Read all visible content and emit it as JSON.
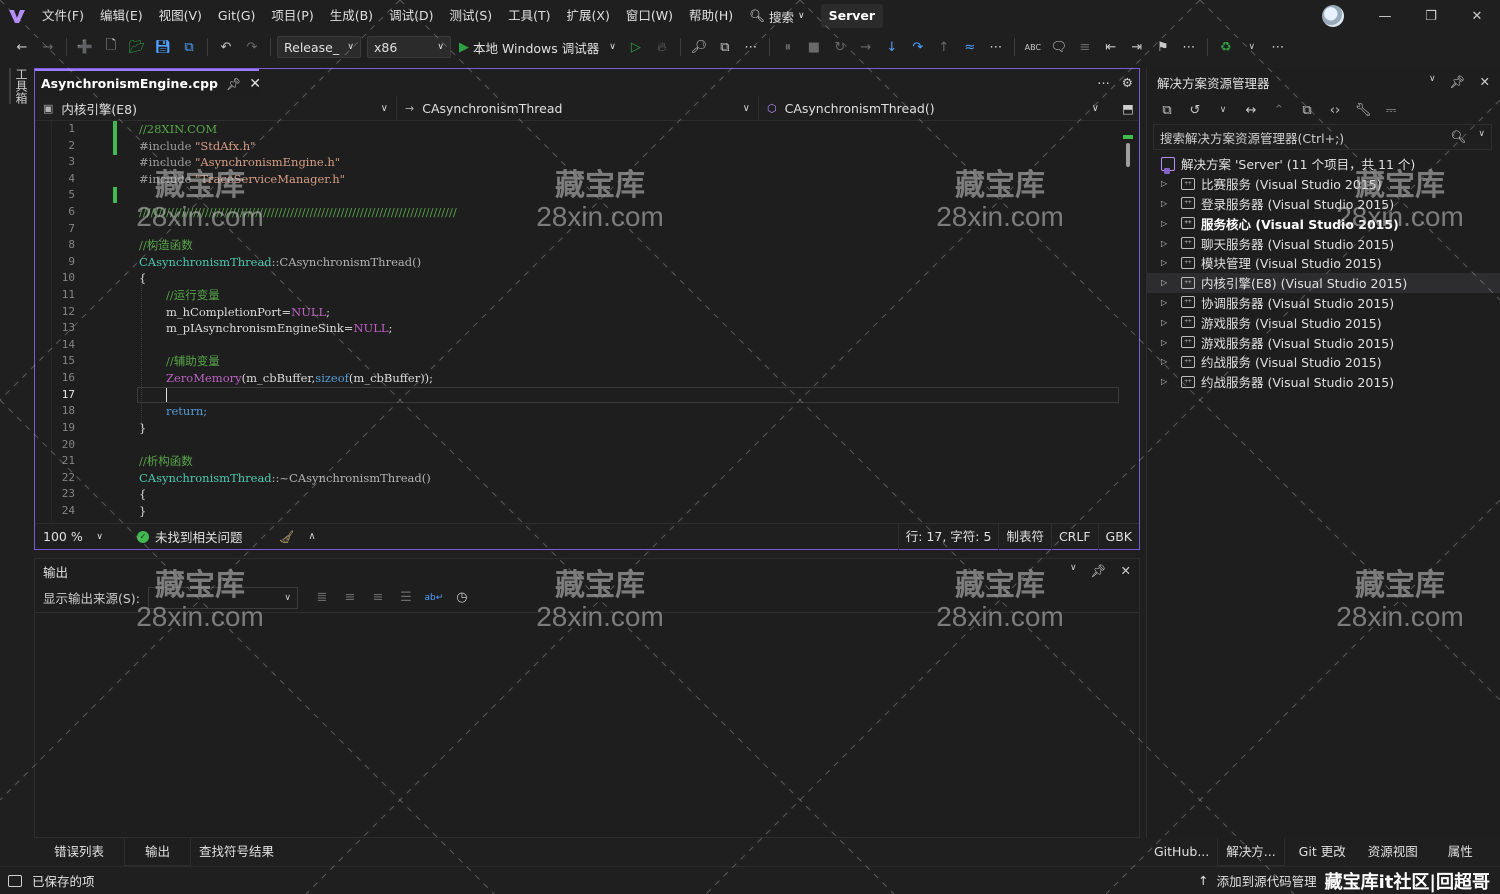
{
  "menu": {
    "items": [
      "文件(F)",
      "编辑(E)",
      "视图(V)",
      "Git(G)",
      "项目(P)",
      "生成(B)",
      "调试(D)",
      "测试(S)",
      "工具(T)",
      "扩展(X)",
      "窗口(W)",
      "帮助(H)"
    ],
    "search_label": "搜索",
    "solution_name": "Server"
  },
  "toolbar": {
    "config": "Release_",
    "platform": "x86",
    "run_label": "本地 Windows 调试器"
  },
  "left_strip": {
    "toolbox_label": "工具箱"
  },
  "editor": {
    "tab_name": "AsynchronismEngine.cpp",
    "nav_project": "内核引擎(E8)",
    "nav_class": "CAsynchronismThread",
    "nav_member": "CAsynchronismThread()",
    "line_numbers": [
      "1",
      "2",
      "3",
      "4",
      "5",
      "6",
      "7",
      "8",
      "9",
      "10",
      "11",
      "12",
      "13",
      "14",
      "15",
      "16",
      "17",
      "18",
      "19",
      "20",
      "21",
      "22",
      "23",
      "24"
    ],
    "current_line": "17",
    "code": {
      "l1": "//28XIN.COM",
      "l2_pre": "#include ",
      "l2_str": "\"StdAfx.h\"",
      "l3_pre": "#include ",
      "l3_str": "\"AsynchronismEngine.h\"",
      "l4_pre": "#include ",
      "l4_str": "\"TraceServiceManager.h\"",
      "l6": "//////////////////////////////////////////////////////////////////////////////////",
      "l8": "//构造函数",
      "l9_type": "CAsynchronismThread",
      "l9_rest": "::CAsynchronismThread()",
      "l10": "{",
      "l11": "//运行变量",
      "l12_a": "m_hCompletionPort=",
      "l12_b": "NULL",
      "l12_c": ";",
      "l13_a": "m_pIAsynchronismEngineSink=",
      "l13_b": "NULL",
      "l13_c": ";",
      "l15": "//辅助变量",
      "l16_fn": "ZeroMemory",
      "l16_a": "(m_cbBuffer,",
      "l16_kw": "sizeof",
      "l16_b": "(m_cbBuffer));",
      "l18": "return;",
      "l19": "}",
      "l21": "//析构函数",
      "l22_type": "CAsynchronismThread",
      "l22_rest": "::~CAsynchronismThread()",
      "l23": "{",
      "l24": "}"
    },
    "zoom": "100 %",
    "issues": "未找到相关问题",
    "position": "行: 17, 字符: 5",
    "indent": "制表符",
    "line_ending": "CRLF",
    "encoding": "GBK"
  },
  "output": {
    "title": "输出",
    "source_label": "显示输出来源(S):"
  },
  "bottom_tabs": [
    "错误列表",
    "输出",
    "查找符号结果"
  ],
  "solution_explorer": {
    "title": "解决方案资源管理器",
    "search_placeholder": "搜索解决方案资源管理器(Ctrl+;)",
    "root": "解决方案 'Server' (11 个项目，共 11 个)",
    "projects": [
      "比赛服务 (Visual Studio 2015)",
      "登录服务器 (Visual Studio 2015)",
      "服务核心 (Visual Studio 2015)",
      "聊天服务器 (Visual Studio 2015)",
      "模块管理 (Visual Studio 2015)",
      "内核引擎(E8) (Visual Studio 2015)",
      "协调服务器 (Visual Studio 2015)",
      "游戏服务 (Visual Studio 2015)",
      "游戏服务器 (Visual Studio 2015)",
      "约战服务 (Visual Studio 2015)",
      "约战服务器 (Visual Studio 2015)"
    ],
    "bold_index": 2,
    "selected_index": 5,
    "bottom_tabs": [
      "GitHub...",
      "解决方...",
      "Git 更改",
      "资源视图",
      "属性"
    ]
  },
  "statusbar": {
    "left": "已保存的项",
    "right": "添加到源代码管理",
    "corner_watermark": "藏宝库it社区|回超哥"
  },
  "watermark": {
    "cn": "藏宝库",
    "en": "28xin.com"
  },
  "colors": {
    "accent": "#7c5cd6",
    "change_bar": "#3fb950",
    "run_green": "#2ea043"
  }
}
